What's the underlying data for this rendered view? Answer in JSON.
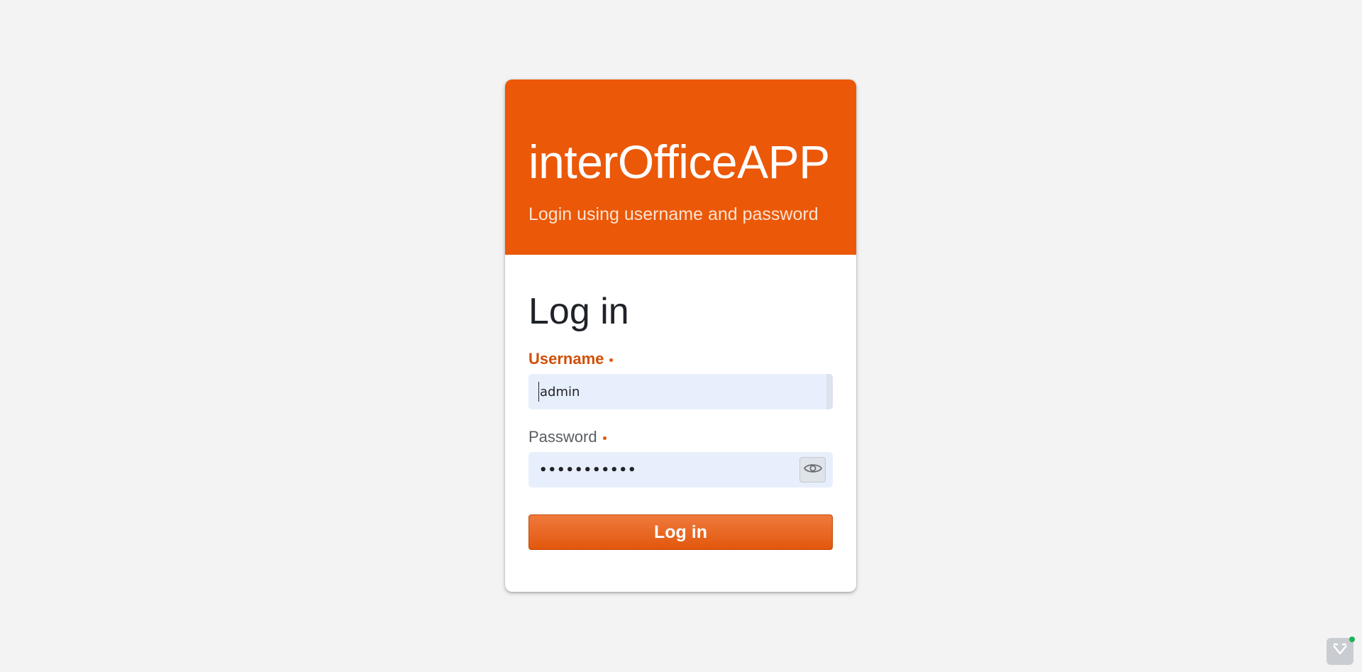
{
  "header": {
    "app_title": "interOfficeAPP",
    "subtitle": "Login using username and password"
  },
  "form": {
    "title": "Log in",
    "username": {
      "label": "Username",
      "value": "admin",
      "required": true
    },
    "password": {
      "label": "Password",
      "masked_value": "•••••••••••",
      "required": true,
      "reveal_icon": "eye-icon"
    },
    "submit_label": "Log in"
  },
  "colors": {
    "brand": "#eb5807",
    "field_background": "#e8effc",
    "page_background": "#f3f3f3"
  },
  "dev_tools": {
    "icon": "vaadin-dev-tools-icon",
    "status": "active"
  }
}
